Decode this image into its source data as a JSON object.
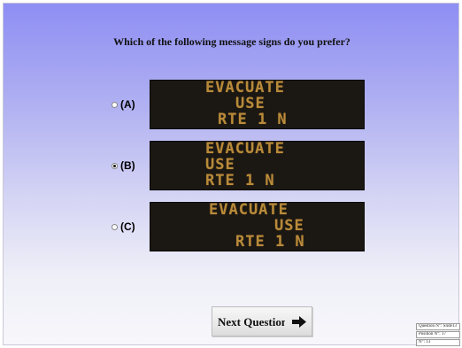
{
  "question": {
    "text": "Which of the following message signs do you prefer?"
  },
  "options": [
    {
      "label": "(A)",
      "selected": false,
      "sign_lines": [
        "EVACUATE",
        "USE",
        "RTE 1 N"
      ],
      "alignment": "centered"
    },
    {
      "label": "(B)",
      "selected": true,
      "sign_lines": [
        "EVACUATE",
        "USE",
        "RTE 1 N"
      ],
      "alignment": "left"
    },
    {
      "label": "(C)",
      "selected": false,
      "sign_lines": [
        "EVACUATE",
        "USE",
        "RTE 1 N"
      ],
      "alignment": "right"
    }
  ],
  "next_button": {
    "label": "Next Question",
    "icon": "arrow-right-icon"
  },
  "info": {
    "question_no": "Question N°: Slide13",
    "position_no": "Position N°: 17",
    "number": "N°: 13"
  },
  "colors": {
    "background_top": "#8e8ef4",
    "background_bottom": "#f7f7fb",
    "sign_background": "#1b1713",
    "sign_text": "#b88a3a"
  }
}
